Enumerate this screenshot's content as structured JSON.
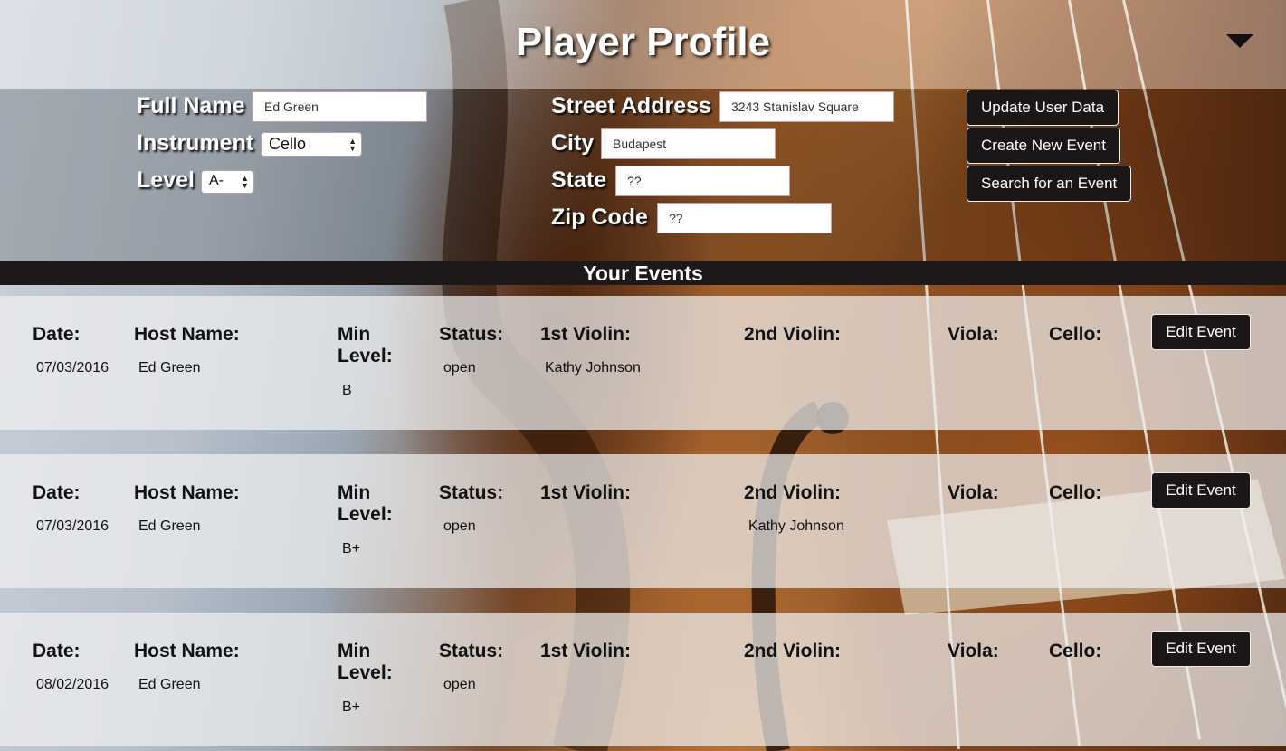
{
  "header": {
    "title": "Player Profile"
  },
  "profile": {
    "full_name_label": "Full Name",
    "full_name_value": "Ed Green",
    "instrument_label": "Instrument",
    "instrument_value": "Cello",
    "level_label": "Level",
    "level_value": "A-",
    "street_label": "Street Address",
    "street_value": "3243 Stanislav Square",
    "city_label": "City",
    "city_value": "Budapest",
    "state_label": "State",
    "state_value": "??",
    "zip_label": "Zip Code",
    "zip_value": "??"
  },
  "actions": {
    "update_label": "Update User Data",
    "create_label": "Create New Event",
    "search_label": "Search for an Event"
  },
  "events": {
    "title": "Your Events",
    "columns": {
      "date": "Date:",
      "host": "Host Name:",
      "min_level": "Min Level:",
      "status": "Status:",
      "violin1": "1st Violin:",
      "violin2": "2nd Violin:",
      "viola": "Viola:",
      "cello": "Cello:"
    },
    "edit_label": "Edit Event",
    "items": [
      {
        "date": "07/03/2016",
        "host": "Ed Green",
        "min_level": "B",
        "status": "open",
        "violin1": "Kathy Johnson",
        "violin2": "",
        "viola": "",
        "cello": ""
      },
      {
        "date": "07/03/2016",
        "host": "Ed Green",
        "min_level": "B+",
        "status": "open",
        "violin1": "",
        "violin2": "Kathy Johnson",
        "viola": "",
        "cello": ""
      },
      {
        "date": "08/02/2016",
        "host": "Ed Green",
        "min_level": "B+",
        "status": "open",
        "violin1": "",
        "violin2": "",
        "viola": "",
        "cello": ""
      }
    ]
  }
}
